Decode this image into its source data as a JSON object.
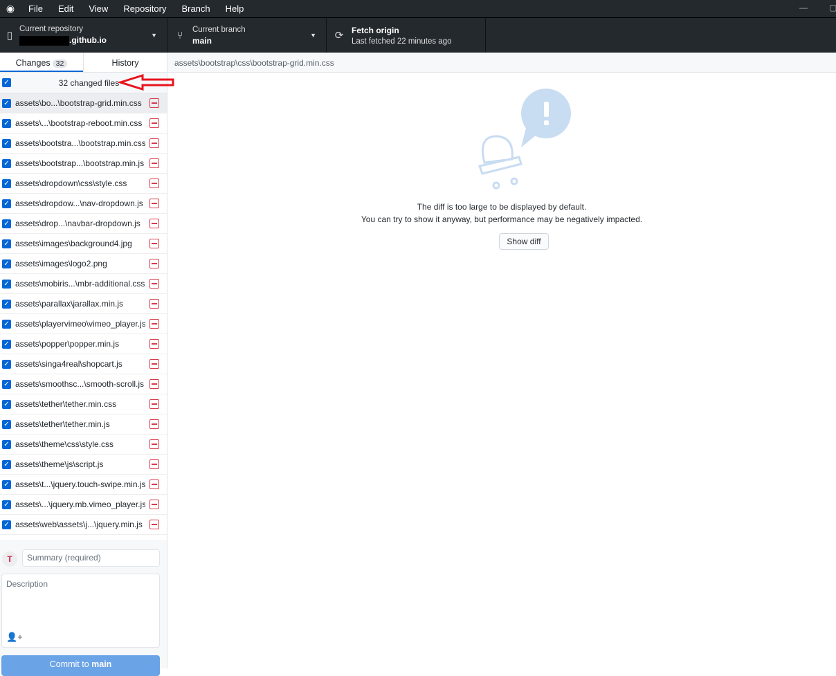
{
  "menu": {
    "items": [
      "File",
      "Edit",
      "View",
      "Repository",
      "Branch",
      "Help"
    ]
  },
  "toolbar": {
    "repo": {
      "label": "Current repository",
      "value": ".github.io"
    },
    "branch": {
      "label": "Current branch",
      "value": "main"
    },
    "fetch": {
      "label": "Fetch origin",
      "sub": "Last fetched 22 minutes ago"
    }
  },
  "tabs": {
    "changes": "Changes",
    "count": "32",
    "history": "History"
  },
  "diff_path": "assets\\bootstrap\\css\\bootstrap-grid.min.css",
  "changes_header": "32 changed files",
  "files": [
    "assets\\bo...\\bootstrap-grid.min.css",
    "assets\\...\\bootstrap-reboot.min.css",
    "assets\\bootstra...\\bootstrap.min.css",
    "assets\\bootstrap...\\bootstrap.min.js",
    "assets\\dropdown\\css\\style.css",
    "assets\\dropdow...\\nav-dropdown.js",
    "assets\\drop...\\navbar-dropdown.js",
    "assets\\images\\background4.jpg",
    "assets\\images\\logo2.png",
    "assets\\mobiris...\\mbr-additional.css",
    "assets\\parallax\\jarallax.min.js",
    "assets\\playervimeo\\vimeo_player.js",
    "assets\\popper\\popper.min.js",
    "assets\\singa4real\\shopcart.js",
    "assets\\smoothsc...\\smooth-scroll.js",
    "assets\\tether\\tether.min.css",
    "assets\\tether\\tether.min.js",
    "assets\\theme\\css\\style.css",
    "assets\\theme\\js\\script.js",
    "assets\\t...\\jquery.touch-swipe.min.js",
    "assets\\...\\jquery.mb.vimeo_player.js",
    "assets\\web\\assets\\j...\\jquery.min.js",
    ""
  ],
  "commit": {
    "summary_placeholder": "Summary (required)",
    "description_placeholder": "Description",
    "button_prefix": "Commit to ",
    "button_branch": "main"
  },
  "diff": {
    "line1": "The diff is too large to be displayed by default.",
    "line2": "You can try to show it anyway, but performance may be negatively impacted.",
    "show_diff": "Show diff"
  },
  "colors": {
    "accent": "#0366d6",
    "deleted": "#d73a49",
    "annotation_arrow": "#e8141c"
  }
}
